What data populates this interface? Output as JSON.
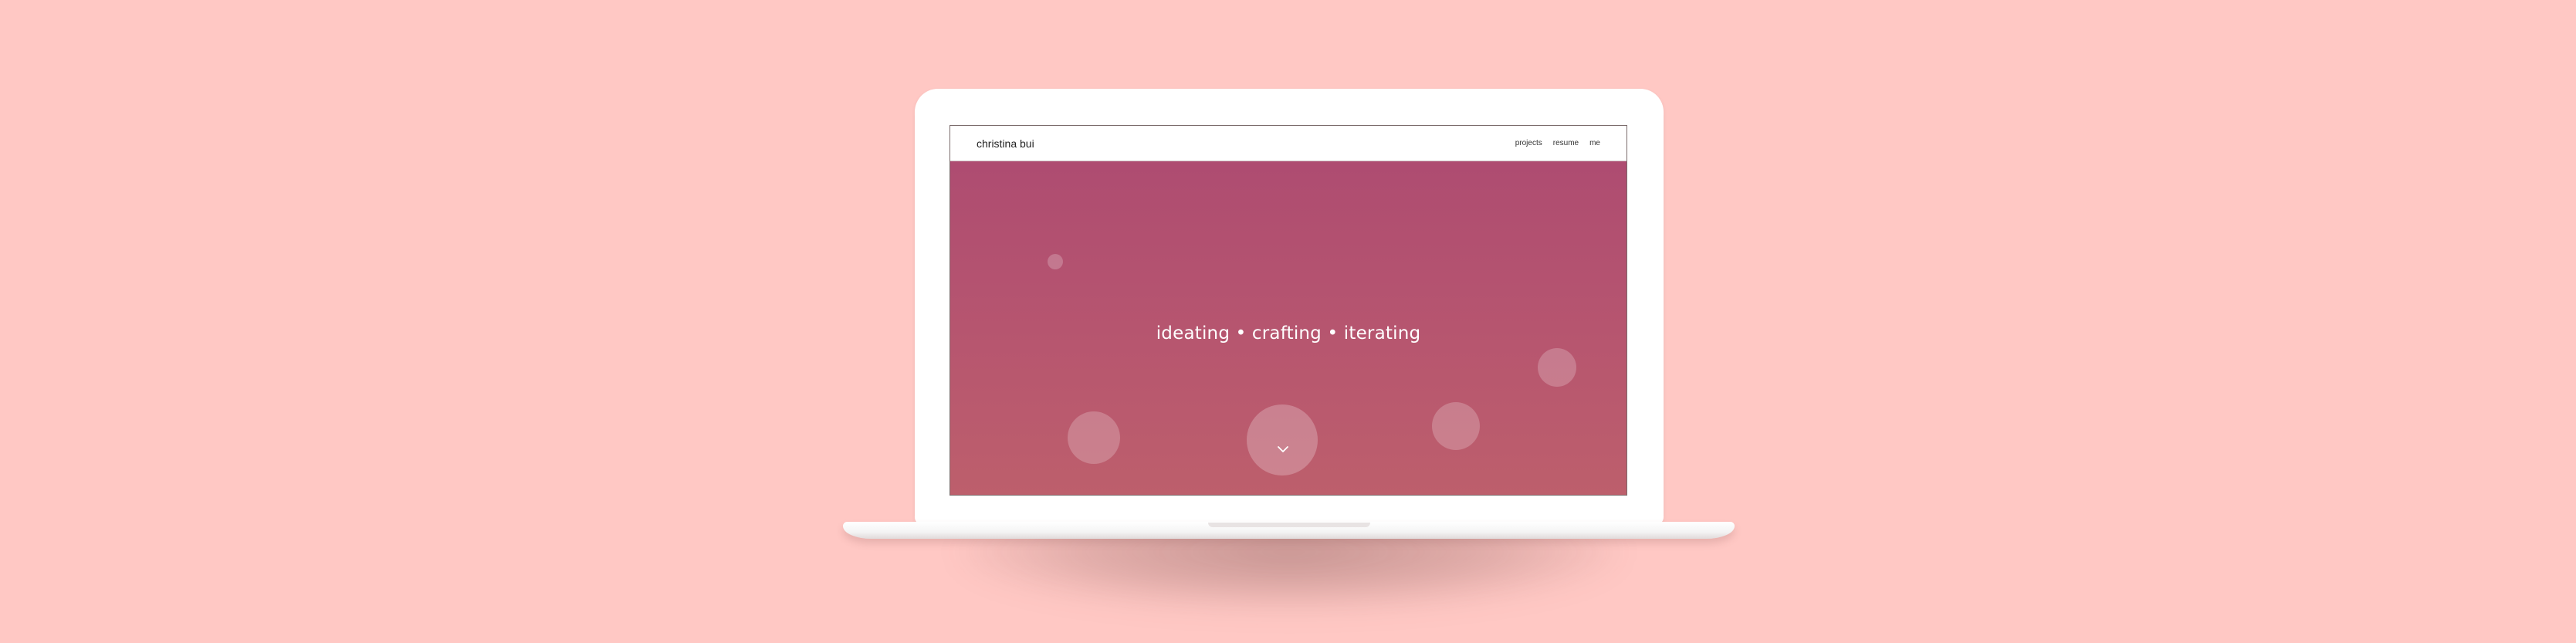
{
  "site": {
    "brand": "christina bui",
    "nav": {
      "items": [
        "projects",
        "resume",
        "me"
      ]
    },
    "hero": {
      "tagline": "ideating • crafting • iterating",
      "scroll_icon": "chevron-down-icon"
    }
  },
  "colors": {
    "background": "#ffc8c4",
    "hero_top": "#ae4c71",
    "hero_bottom": "#bd5f6c",
    "laptop": "#ffffff"
  }
}
